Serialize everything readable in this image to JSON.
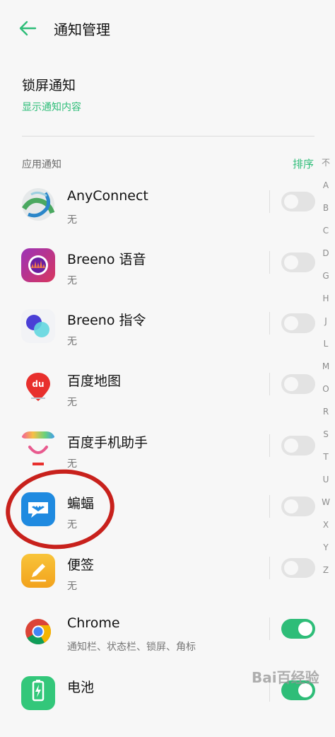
{
  "header": {
    "title": "通知管理"
  },
  "lock_screen": {
    "title": "锁屏通知",
    "value": "显示通知内容"
  },
  "section": {
    "label": "应用通知",
    "sort_label": "排序"
  },
  "index_letters": [
    "不",
    "A",
    "B",
    "C",
    "D",
    "G",
    "H",
    "J",
    "L",
    "M",
    "O",
    "R",
    "S",
    "T",
    "U",
    "W",
    "X",
    "Y",
    "Z"
  ],
  "apps": [
    {
      "name": "AnyConnect",
      "sub": "无",
      "enabled": false,
      "icon": "anyconnect-icon"
    },
    {
      "name": "Breeno 语音",
      "sub": "无",
      "enabled": false,
      "icon": "breeno-voice-icon"
    },
    {
      "name": "Breeno 指令",
      "sub": "无",
      "enabled": false,
      "icon": "breeno-command-icon"
    },
    {
      "name": "百度地图",
      "sub": "无",
      "enabled": false,
      "icon": "baidu-map-icon"
    },
    {
      "name": "百度手机助手",
      "sub": "无",
      "enabled": false,
      "icon": "baidu-assistant-icon"
    },
    {
      "name": "蝙蝠",
      "sub": "无",
      "enabled": false,
      "icon": "bat-icon"
    },
    {
      "name": "便签",
      "sub": "无",
      "enabled": false,
      "icon": "notes-icon"
    },
    {
      "name": "Chrome",
      "sub": "通知栏、状态栏、锁屏、角标",
      "enabled": true,
      "icon": "chrome-icon"
    },
    {
      "name": "电池",
      "sub": "",
      "enabled": true,
      "icon": "battery-icon"
    }
  ],
  "watermark": "Bai百经验",
  "colors": {
    "accent": "#2ebd78",
    "highlight_circle": "#c8211c"
  }
}
